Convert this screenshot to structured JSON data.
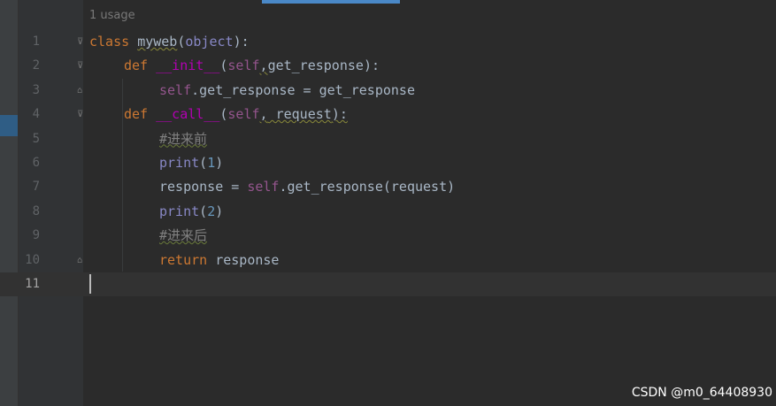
{
  "editor": {
    "usage_hint": "1 usage",
    "lines": [
      {
        "number": "1"
      },
      {
        "number": "2"
      },
      {
        "number": "3"
      },
      {
        "number": "4"
      },
      {
        "number": "5"
      },
      {
        "number": "6"
      },
      {
        "number": "7"
      },
      {
        "number": "8"
      },
      {
        "number": "9"
      },
      {
        "number": "10"
      },
      {
        "number": "11"
      }
    ],
    "tokens": {
      "l1_kw": "class",
      "l1_name": "myweb",
      "l1_open": "(",
      "l1_base": "object",
      "l1_close": "):",
      "l2_kw": "def",
      "l2_name": "__init__",
      "l2_open": "(",
      "l2_self": "self",
      "l2_comma": ",",
      "l2_param": "get_response",
      "l2_close": "):",
      "l3_self": "self",
      "l3_rest": ".get_response = get_response",
      "l4_kw": "def",
      "l4_name": "__call__",
      "l4_open": "(",
      "l4_self": "self",
      "l4_comma": ",",
      "l4_param": " request",
      "l4_close": "):",
      "l5_comment": "#进来前",
      "l6_fn": "print",
      "l6_open": "(",
      "l6_num": "1",
      "l6_close": ")",
      "l7_a": "response = ",
      "l7_self": "self",
      "l7_b": ".get_response(request)",
      "l8_fn": "print",
      "l8_open": "(",
      "l8_num": "2",
      "l8_close": ")",
      "l9_comment": "#进来后",
      "l10_kw": "return",
      "l10_rest": " response"
    }
  },
  "watermark": "CSDN @m0_64408930",
  "colors": {
    "background": "#2b2b2b",
    "keyword": "#cc7832",
    "magic_method": "#b200b2",
    "self": "#94558d",
    "builtin": "#8888c6",
    "number": "#6897bb",
    "comment": "#808080",
    "text": "#a9b7c6"
  }
}
